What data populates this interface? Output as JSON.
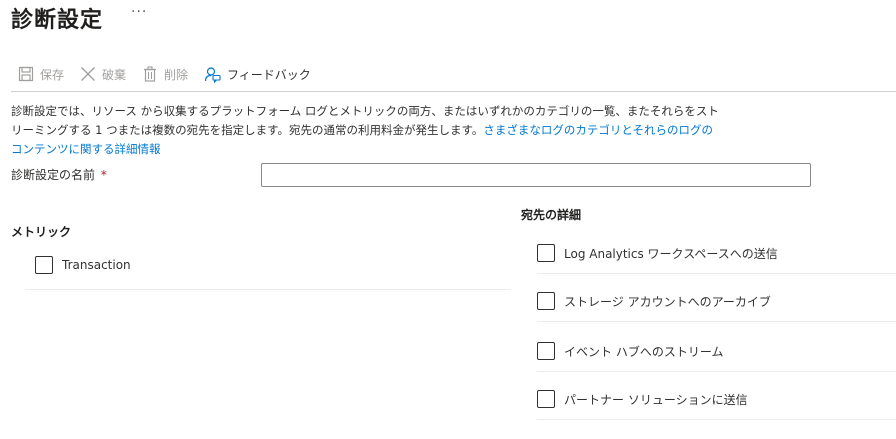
{
  "page": {
    "title": "診断設定",
    "more_label": "···"
  },
  "toolbar": {
    "save_label": "保存",
    "discard_label": "破棄",
    "delete_label": "削除",
    "feedback_label": "フィードバック"
  },
  "description": {
    "text": "診断設定では、リソース から収集するプラットフォーム ログとメトリックの両方、またはいずれかのカテゴリの一覧、またそれらをストリーミングする 1 つまたは複数の宛先を指定します。宛先の通常の利用料金が発生します。",
    "link_text": "さまざまなログのカテゴリとそれらのログのコンテンツに関する詳細情報"
  },
  "name_field": {
    "label": "診断設定の名前",
    "required_mark": "*",
    "value": "",
    "placeholder": ""
  },
  "metrics": {
    "heading": "メトリック",
    "items": [
      {
        "label": "Transaction",
        "checked": false
      }
    ]
  },
  "destinations": {
    "heading": "宛先の詳細",
    "items": [
      {
        "label": "Log Analytics ワークスペースへの送信",
        "checked": false
      },
      {
        "label": "ストレージ アカウントへのアーカイブ",
        "checked": false
      },
      {
        "label": "イベント ハブへのストリーム",
        "checked": false
      },
      {
        "label": "パートナー ソリューションに送信",
        "checked": false
      }
    ]
  },
  "colors": {
    "link": "#0078d4",
    "required": "#a4262c",
    "disabled_text": "#a19f9d"
  }
}
